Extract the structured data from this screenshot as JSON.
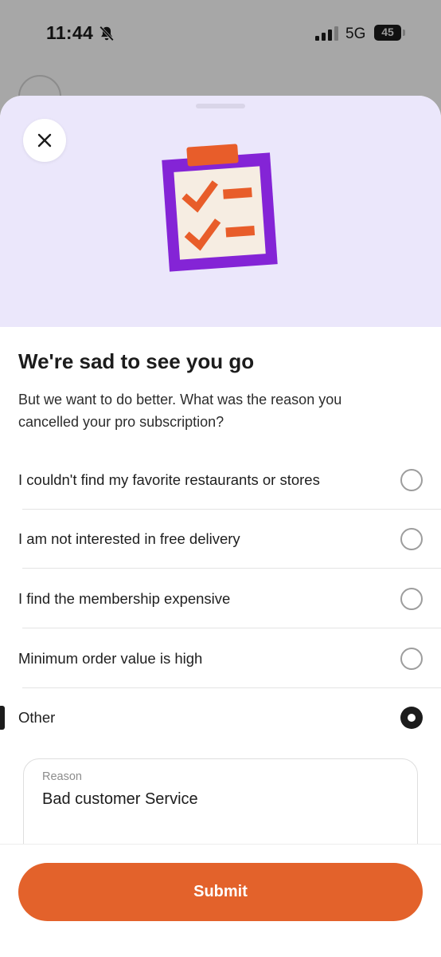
{
  "status_bar": {
    "time": "11:44",
    "network": "5G",
    "battery": "45",
    "icons": [
      "bell-slash-icon",
      "signal-bars-icon",
      "battery-icon"
    ]
  },
  "sheet": {
    "close_icon": "close-icon",
    "illustration": "clipboard-checklist-icon",
    "title": "We're sad to see you go",
    "subtitle": "But we want to do better. What was the reason you cancelled your pro subscription?",
    "options": [
      {
        "label": "I couldn't find my favorite restaurants or stores",
        "selected": false
      },
      {
        "label": "I am not interested in free delivery",
        "selected": false
      },
      {
        "label": "I find the membership expensive",
        "selected": false
      },
      {
        "label": "Minimum order value is high",
        "selected": false
      },
      {
        "label": "Other",
        "selected": true
      }
    ],
    "reason": {
      "label": "Reason",
      "value": "Bad customer Service"
    },
    "submit_label": "Submit"
  },
  "colors": {
    "accent": "#e3622b",
    "hero_background": "#ebe7fb",
    "clipboard_purple": "#8424d6",
    "selected_radio": "#1c1c1c"
  }
}
